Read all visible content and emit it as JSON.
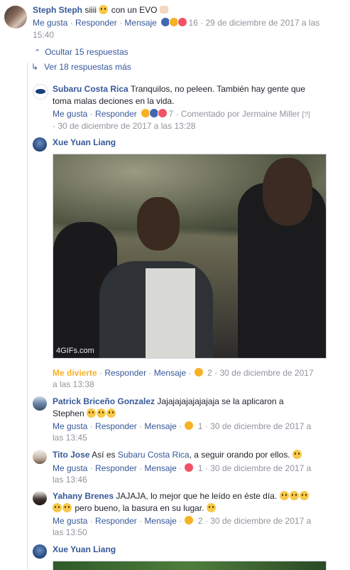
{
  "c1": {
    "author": "Steph Steph",
    "text": "siiii",
    "text2": "con un EVO",
    "like": "Me gusta",
    "reply": "Responder",
    "message": "Mensaje",
    "count": "16",
    "date_a": "29 de diciembre de 2017 a las",
    "date_b": "15:40"
  },
  "hide_replies": "Ocultar 15 respuestas",
  "more_replies": "Ver 18 respuestas más",
  "r1": {
    "author": "Subaru Costa Rica",
    "text_a": "Tranquilos, no peleen. También hay gente que",
    "text_b": "toma malas deciones en la vida.",
    "like": "Me gusta",
    "reply": "Responder",
    "count": "7",
    "commented_by": "Comentado por Jermaine Miller",
    "help": "[?]",
    "date": "· 30 de diciembre de 2017 a las 13:28"
  },
  "r2": {
    "author": "Xue Yuan Liang",
    "gif_watermark": "4GIFs.com",
    "like": "Me divierte",
    "reply": "Responder",
    "message": "Mensaje",
    "count": "2",
    "date_a": "30 de diciembre de 2017",
    "date_b": "a las 13:38"
  },
  "r3": {
    "author": "Patrick Briceño Gonzalez",
    "text_a": "Jajajajajajajajaja se la aplicaron a",
    "text_b": "Stephen",
    "like": "Me gusta",
    "reply": "Responder",
    "message": "Mensaje",
    "count": "1",
    "date_a": "30 de diciembre de 2017 a",
    "date_b": "las 13:45"
  },
  "r4": {
    "author": "Tito Jose",
    "text_pre": "Así es",
    "mention": "Subaru Costa Rica",
    "text_post": ", a seguir orando por ellos.",
    "like": "Me gusta",
    "reply": "Responder",
    "message": "Mensaje",
    "count": "1",
    "date_a": "30 de diciembre de 2017 a",
    "date_b": "las 13:46"
  },
  "r5": {
    "author": "Yahany Brenes",
    "text_a": "JAJAJA, lo mejor que he leído en éste día.",
    "text_b": "pero bueno, la basura en su lugar.",
    "like": "Me gusta",
    "reply": "Responder",
    "message": "Mensaje",
    "count": "2",
    "date_a": "30 de diciembre de 2017 a",
    "date_b": "las 13:50"
  },
  "r6": {
    "author": "Xue Yuan Liang"
  },
  "colors": {
    "link": "#365899",
    "meta": "#90949c",
    "haha": "#f7b125",
    "like_blue": "#4267b2",
    "love_red": "#f25268"
  }
}
